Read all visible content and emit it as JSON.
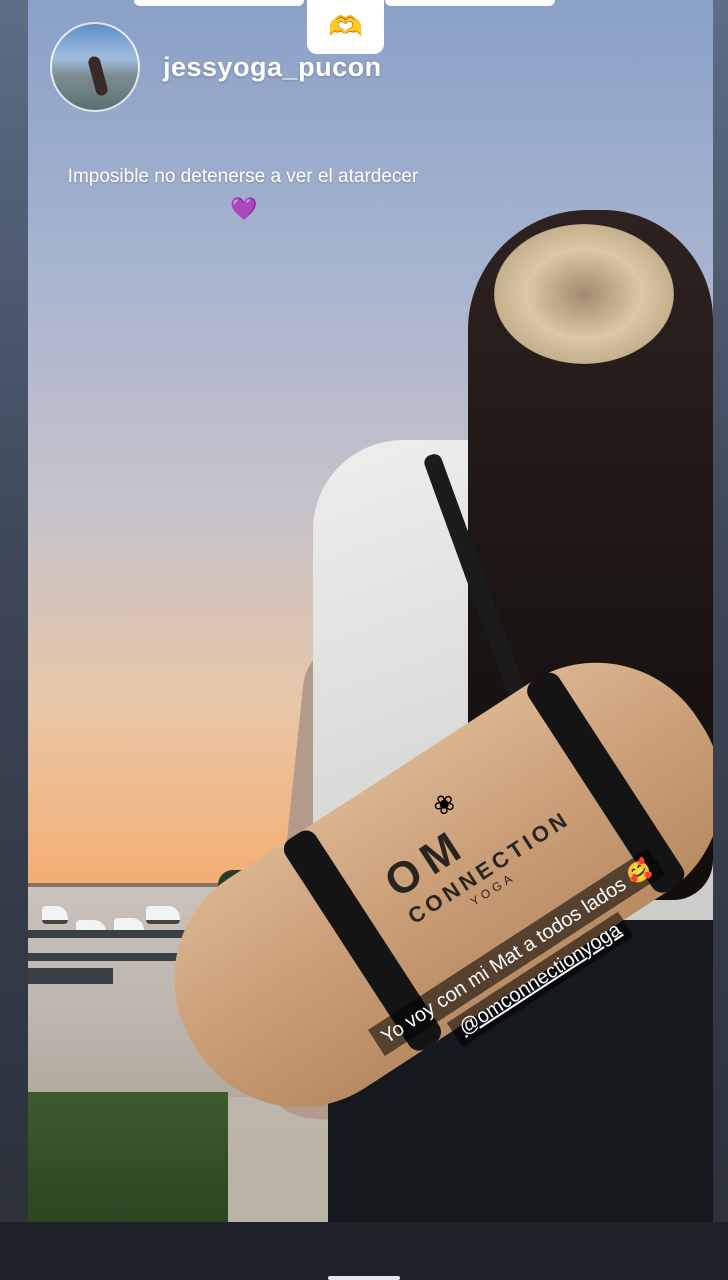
{
  "story": {
    "username": "jessyoga_pucon",
    "caption": "Imposible no detenerse a ver el atardecer",
    "caption_emoji": "💜",
    "top_sticker_emoji": "🫶",
    "mat_brand": {
      "line1": "OM",
      "line2": "CONNECTION",
      "line3": "YOGA"
    },
    "text_sticker": {
      "line1": "Yo voy con mi Mat a todos lados 🥰",
      "mention": "@omconnectionyoga"
    }
  },
  "colors": {
    "sky_top": "#8aa0c8",
    "sunset": "#f2a15f",
    "text": "#ffffff"
  },
  "icons": [
    "heart-hands-icon",
    "lotus-icon"
  ]
}
